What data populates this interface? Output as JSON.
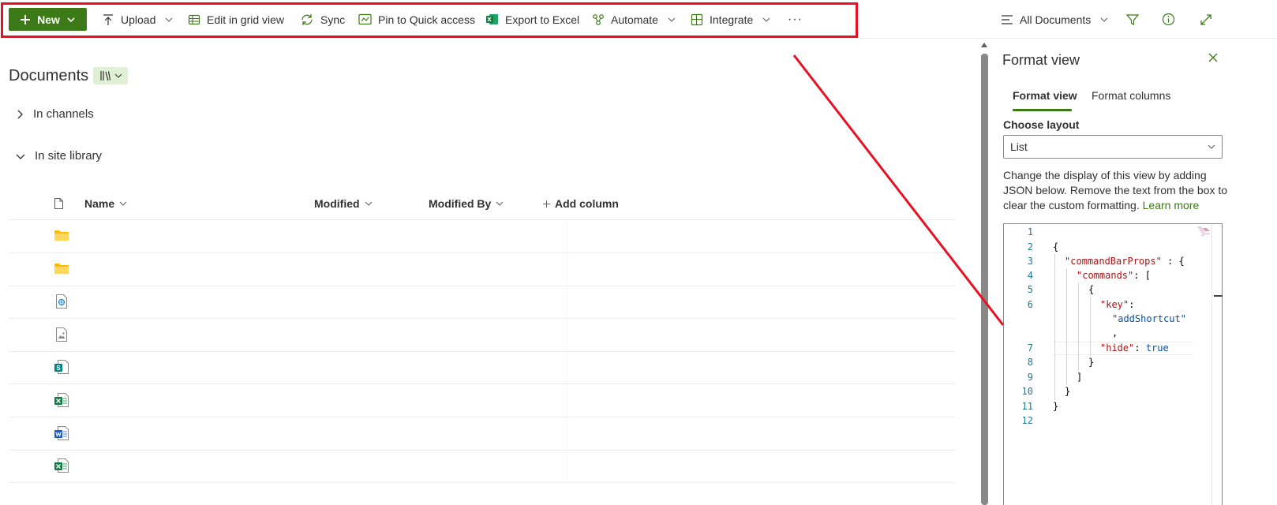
{
  "commandbar": {
    "new_label": "New",
    "items": [
      {
        "label": "Upload",
        "icon": "upload-icon"
      },
      {
        "label": "Edit in grid view",
        "icon": "grid-view-icon"
      },
      {
        "label": "Sync",
        "icon": "sync-icon"
      },
      {
        "label": "Pin to Quick access",
        "icon": "pin-icon"
      },
      {
        "label": "Export to Excel",
        "icon": "excel-icon"
      },
      {
        "label": "Automate",
        "icon": "automate-icon"
      },
      {
        "label": "Integrate",
        "icon": "integrate-icon"
      }
    ],
    "more_label": "···",
    "view_label": "All Documents",
    "accent_color": "#3c7a17",
    "highlight_color": "#e81123"
  },
  "library": {
    "title": "Documents",
    "groups": [
      {
        "label": "In channels",
        "expanded": false
      },
      {
        "label": "In site library",
        "expanded": true
      }
    ],
    "columns": [
      "Name",
      "Modified",
      "Modified By"
    ],
    "add_column_label": "Add column",
    "rows": [
      {
        "type": "folder-icon"
      },
      {
        "type": "folder-icon"
      },
      {
        "type": "web-page-file-icon"
      },
      {
        "type": "image-file-icon"
      },
      {
        "type": "sharepoint-file-icon"
      },
      {
        "type": "excel-file-icon"
      },
      {
        "type": "word-file-icon"
      },
      {
        "type": "excel-file-icon"
      }
    ]
  },
  "panel": {
    "title": "Format view",
    "tabs": [
      "Format view",
      "Format columns"
    ],
    "active_tab": "Format view",
    "choose_layout_label": "Choose layout",
    "layout_value": "List",
    "description": "Change the display of this view by adding JSON below. Remove the text from the box to clear the custom formatting.",
    "learn_more": "Learn more",
    "editor": {
      "line_numbers": [
        "1",
        "2",
        "3",
        "4",
        "5",
        "6",
        "7",
        "8",
        "9",
        "10",
        "11",
        "12"
      ],
      "lines": [
        {
          "text": "{"
        },
        {
          "key": "\"commandBarProps\"",
          "rest": " : {"
        },
        {
          "key": "\"commands\"",
          "rest": ": ["
        },
        {
          "text": "{"
        },
        {
          "key": "\"key\"",
          "rest": ":"
        },
        {
          "value": "\"addShortcut\""
        },
        {
          "text": ","
        },
        {
          "key": "\"hide\"",
          "rest": ": ",
          "bool": "true"
        },
        {
          "text": "}"
        },
        {
          "text": "]"
        },
        {
          "text": "}"
        },
        {
          "text": "}"
        }
      ]
    }
  }
}
